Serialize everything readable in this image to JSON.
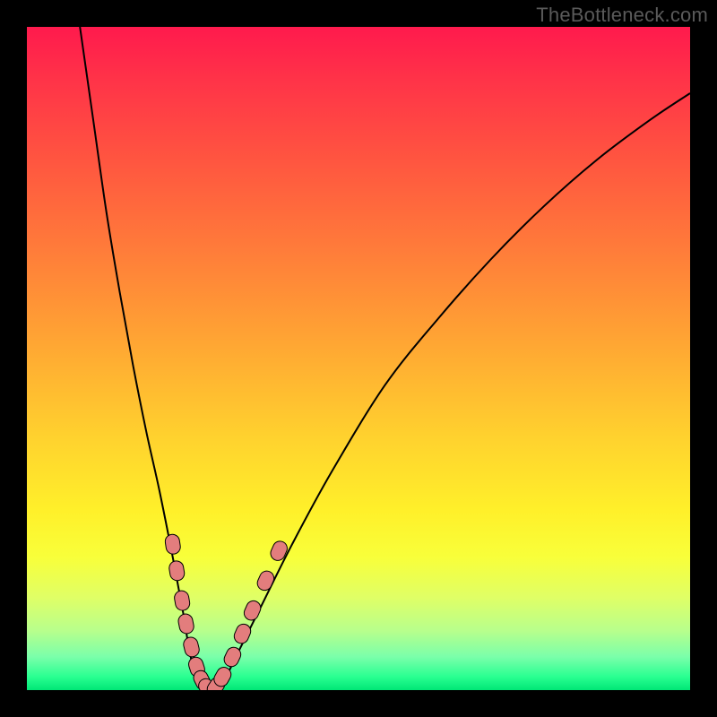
{
  "watermark": "TheBottleneck.com",
  "colors": {
    "background": "#000000",
    "curve": "#000000",
    "marker_fill": "#e37d7d",
    "marker_stroke": "#000000",
    "gradient_top": "#ff1a4d",
    "gradient_mid": "#ffd22e",
    "gradient_bottom": "#00e676",
    "watermark": "#5a5a5a"
  },
  "chart_data": {
    "type": "line",
    "title": "",
    "subtitle": "",
    "xlabel": "",
    "ylabel": "",
    "xlim": [
      0,
      100
    ],
    "ylim": [
      0,
      100
    ],
    "grid": false,
    "legend": false,
    "annotations": [
      "TheBottleneck.com"
    ],
    "series": [
      {
        "name": "curve",
        "x": [
          8,
          10,
          12,
          14,
          16,
          18,
          20,
          22,
          23.5,
          24.5,
          25.5,
          27,
          28.5,
          30,
          32,
          35,
          40,
          46,
          54,
          62,
          70,
          78,
          86,
          94,
          100
        ],
        "y": [
          100,
          86,
          72,
          60,
          49,
          39,
          30,
          20,
          12,
          6,
          2,
          0,
          0.2,
          2,
          6,
          12,
          22,
          33,
          46,
          56,
          65,
          73,
          80,
          86,
          90
        ]
      },
      {
        "name": "markers-left-branch",
        "x": [
          22.0,
          22.6,
          23.4,
          24.0,
          24.8,
          25.6,
          26.4,
          27.2
        ],
        "y": [
          22.0,
          18.0,
          13.5,
          10.0,
          6.5,
          3.5,
          1.5,
          0.3
        ]
      },
      {
        "name": "markers-right-branch",
        "x": [
          28.5,
          29.5,
          31.0,
          32.5,
          34.0,
          36.0,
          38.0
        ],
        "y": [
          0.5,
          2.0,
          5.0,
          8.5,
          12.0,
          16.5,
          21.0
        ]
      }
    ],
    "note": "Axis units are not labeled in the source image; x and y are expressed as percentage of the plot area (0 = left/bottom edge, 100 = right/top edge). Values are visually estimated from the rendered curve and marker positions."
  }
}
